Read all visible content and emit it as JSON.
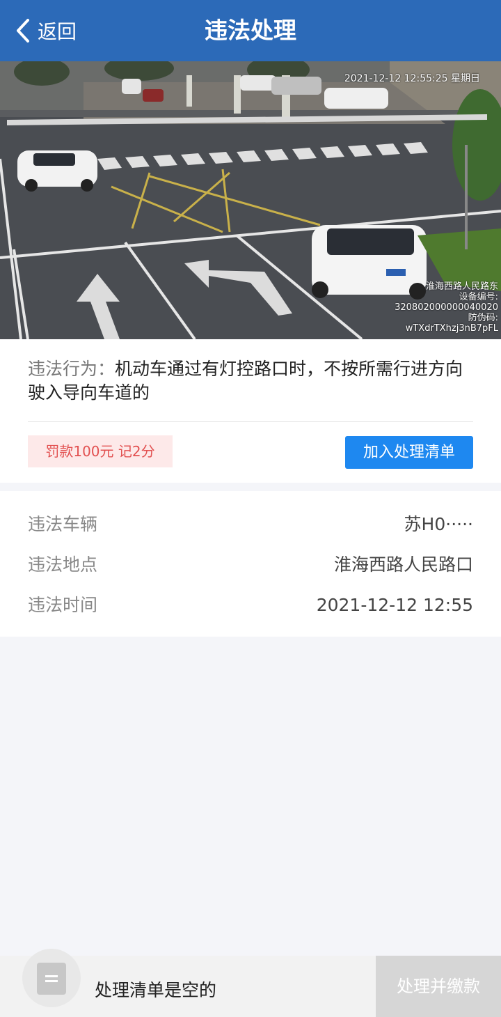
{
  "header": {
    "back_label": "返回",
    "title": "违法处理"
  },
  "photo": {
    "timestamp": "2021-12-12 12:55:25 星期日",
    "overlay_lines": [
      "淮海西路人民路东",
      "设备编号:",
      "320802000000040020",
      "防伪码:",
      "wTXdrTXhzj3nB7pFL"
    ]
  },
  "violation": {
    "label": "违法行为：",
    "text": "机动车通过有灯控路口时，不按所需行进方向驶入导向车道的",
    "penalty": "罚款100元 记2分",
    "add_button": "加入处理清单"
  },
  "details": [
    {
      "label": "违法车辆",
      "value": "苏H0·····"
    },
    {
      "label": "违法地点",
      "value": "淮海西路人民路口"
    },
    {
      "label": "违法时间",
      "value": "2021-12-12 12:55"
    }
  ],
  "bottom": {
    "empty_text": "处理清单是空的",
    "pay_button": "处理并缴款"
  },
  "colors": {
    "header": "#2c6ab8",
    "accent": "#1e88f0",
    "penalty_text": "#e25050"
  }
}
